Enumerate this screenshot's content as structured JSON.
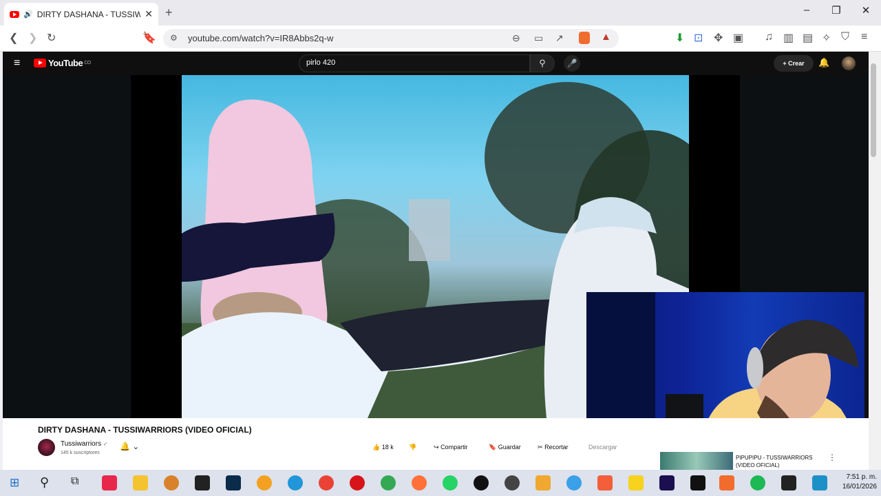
{
  "browser": {
    "tab_title": "DIRTY DASHANA - TUSSIWARRIORS",
    "new_tab": "+",
    "url": "youtube.com/watch?v=IR8Abbs2q-w",
    "window_buttons": [
      "–",
      "❐",
      "✕"
    ]
  },
  "youtube": {
    "logo_text": "YouTube",
    "logo_sup": "CO",
    "search_value": "pirlo 420",
    "create_label": "Crear",
    "video_title": "DIRTY DASHANA - TUSSIWARRIORS (VIDEO OFICIAL)",
    "channel_name": "Tussiwarriors",
    "subscribers": "145 k suscriptores",
    "likes": "18 k",
    "share_label": "Compartir",
    "save_label": "Guardar",
    "clip_label": "Recortar",
    "download_label": "Descargar",
    "next_video_title": "PIPUPIPU - TUSSIWARRIORS",
    "next_video_subtitle": "(VIDEO OFICIAL)"
  },
  "taskbar": {
    "time": "7:51 p. m.",
    "date": "16/01/2026"
  },
  "colors": {
    "youtube_red": "#ff0000",
    "yt_dark": "#0f0f0f",
    "taskbar": "#dde2ec"
  }
}
